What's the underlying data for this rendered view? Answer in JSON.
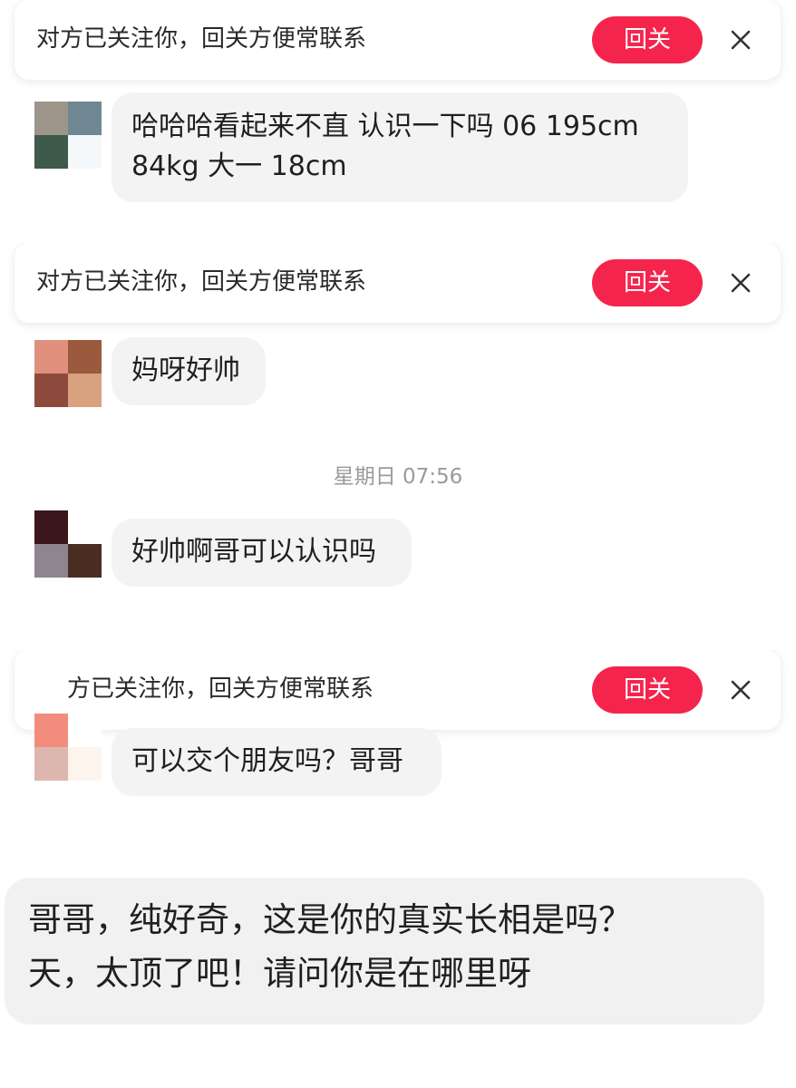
{
  "follow_banner": {
    "text": "对方已关注你，回关方便常联系",
    "text_partial": "方已关注你，回关方便常联系",
    "button_label": "回关"
  },
  "messages": [
    {
      "text": "哈哈哈看起来不直 认识一下吗 06 195cm 84kg 大一 18cm"
    },
    {
      "text": "妈呀好帅"
    },
    {
      "text": "好帅啊哥可以认识吗"
    },
    {
      "text": "可以交个朋友吗？哥哥"
    }
  ],
  "timestamp": "星期日 07:56",
  "bottom_message": {
    "line1": "哥哥，纯好奇，这是你的真实长相是吗？",
    "line2": "天，太顶了吧！请问你是在哪里呀"
  },
  "colors": {
    "accent": "#f5244c",
    "bubble": "#f3f3f3",
    "timestamp": "#9a9a9a"
  }
}
